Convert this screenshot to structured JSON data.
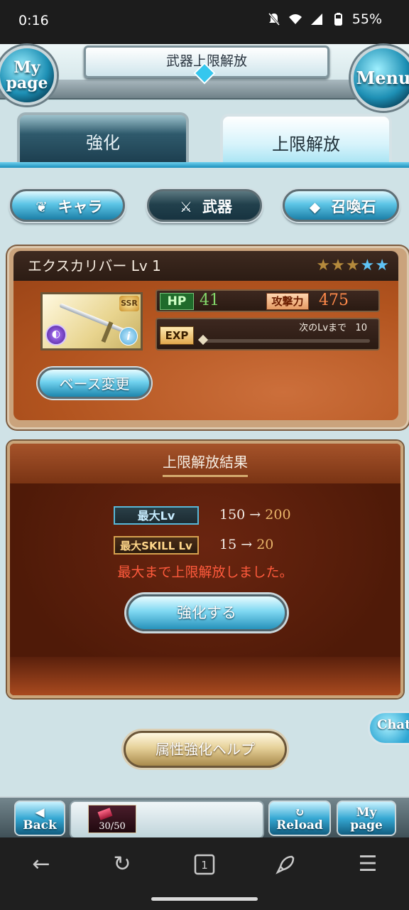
{
  "status_bar": {
    "time": "0:16",
    "battery": "55%"
  },
  "header": {
    "title": "武器上限解放",
    "mypage_label": "My page",
    "menu_label": "Menu"
  },
  "tabs": {
    "enhance": "強化",
    "limit_break": "上限解放"
  },
  "categories": {
    "chara": "キャラ",
    "weapon": "武器",
    "summon": "召喚石"
  },
  "weapon": {
    "name": "エクスカリバー Lv 1",
    "stars_gold": "★★★",
    "stars_blue": "★★",
    "rarity": "SSR",
    "hp_label": "HP",
    "hp": "41",
    "atk_label": "攻撃力",
    "atk": "475",
    "exp_label": "EXP",
    "next_lv_label": "次のLvまで",
    "next_lv_value": "10",
    "exp_progress": 0,
    "base_change_label": "ベース変更"
  },
  "result": {
    "title": "上限解放結果",
    "max_lv_label": "最大Lv",
    "max_lv_old": "150 →",
    "max_lv_new": "200",
    "max_skill_label": "最大SKILL Lv",
    "max_skill_old": "15 →",
    "max_skill_new": "20",
    "message": "最大まで上限解放しました。",
    "enhance_button": "強化する"
  },
  "help_button": "属性強化ヘルプ",
  "chat_label": "Chat",
  "bottom_bar": {
    "back": "Back",
    "reload": "Reload",
    "mypage": "My page",
    "ap": "30/50"
  },
  "colors": {
    "accent": "#2fa8d3",
    "panel_brown": "#b2541f",
    "result_bg": "#4f1a08",
    "alert": "#ff5a3c"
  }
}
